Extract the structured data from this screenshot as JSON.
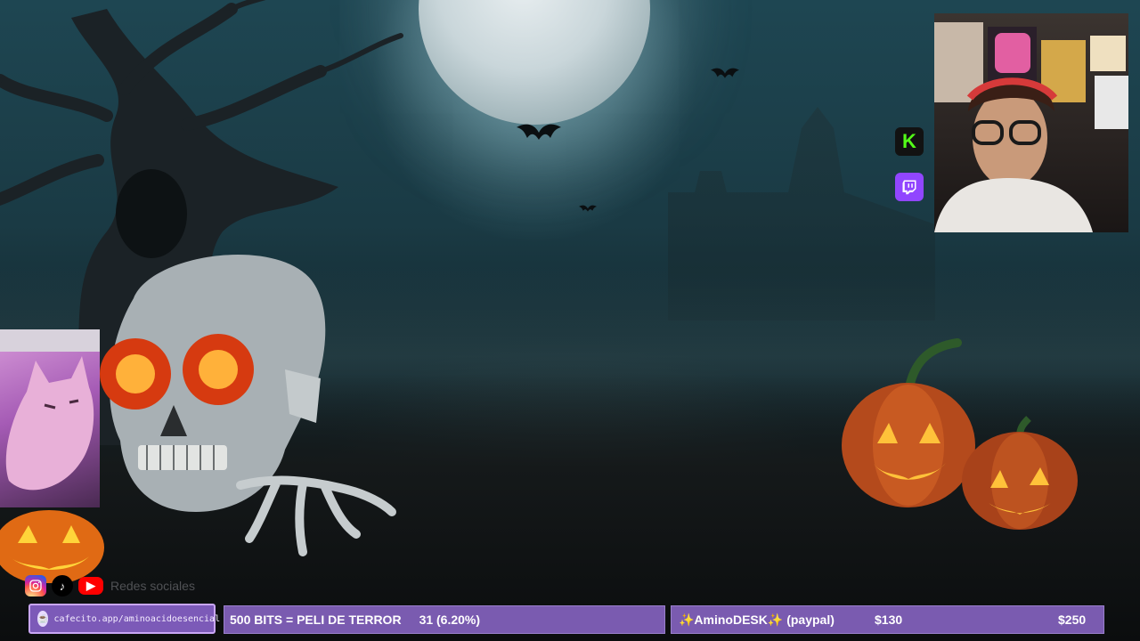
{
  "overlay": {
    "cafecito_url": "cafecito.app/aminoacidoesencial",
    "socials_label": "Redes sociales",
    "goal_bits": {
      "label": "500 BITS = PELI DE TERROR",
      "progress": "31 (6.20%)"
    },
    "goal_paypal": {
      "label": "✨AminoDESK✨ (paypal)",
      "current": "$130",
      "target": "$250"
    }
  },
  "icons": {
    "kick": "K",
    "twitch": "twitch-glyph",
    "instagram": "instagram",
    "tiktok": "♪",
    "youtube": "▶"
  },
  "colors": {
    "bar_purple": "#7a5bb0",
    "kick_green": "#53fc18",
    "twitch_purple": "#9146ff"
  }
}
